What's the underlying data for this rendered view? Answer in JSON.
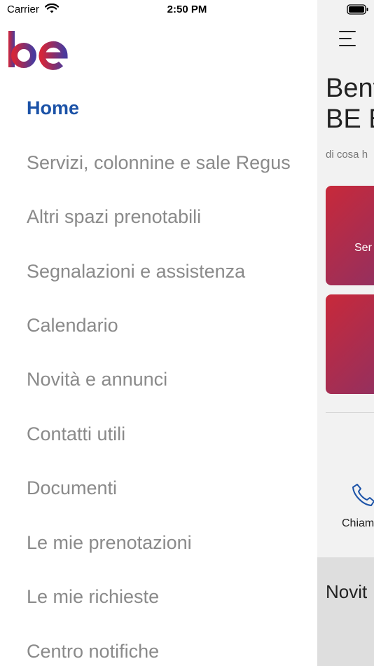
{
  "status_bar": {
    "carrier": "Carrier",
    "time": "2:50 PM"
  },
  "logo": {
    "text": "be"
  },
  "menu": {
    "items": [
      {
        "label": "Home",
        "active": true
      },
      {
        "label": "Servizi, colonnine e sale Regus",
        "active": false
      },
      {
        "label": "Altri spazi prenotabili",
        "active": false
      },
      {
        "label": "Segnalazioni e assistenza",
        "active": false
      },
      {
        "label": "Calendario",
        "active": false
      },
      {
        "label": "Novità e annunci",
        "active": false
      },
      {
        "label": "Contatti utili",
        "active": false
      },
      {
        "label": "Documenti",
        "active": false
      },
      {
        "label": "Le mie prenotazioni",
        "active": false
      },
      {
        "label": "Le mie richieste",
        "active": false
      },
      {
        "label": "Centro notifiche",
        "active": false
      }
    ]
  },
  "main": {
    "welcome_title_line1": "Benv",
    "welcome_title_line2": "BE E",
    "welcome_subtitle": "di cosa h",
    "card_1_label": "Ser",
    "call_label": "Chiam",
    "news_label": "Novit"
  },
  "colors": {
    "accent": "#1b52a7",
    "menu_text": "#8a8a8a",
    "card_gradient_start": "#c8293a",
    "card_gradient_end": "#6d3a80"
  },
  "icons": {
    "wifi": "wifi-icon",
    "battery": "battery-icon",
    "menu": "hamburger-menu-icon",
    "phone": "phone-icon"
  }
}
